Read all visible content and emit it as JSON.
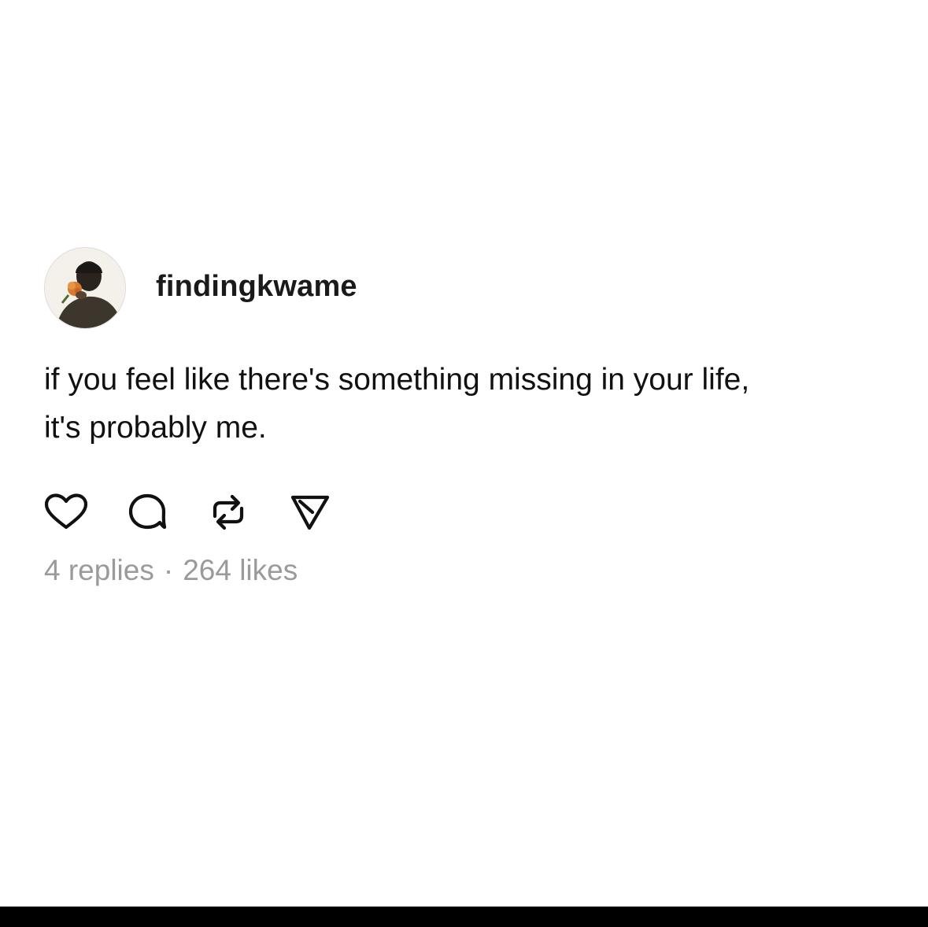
{
  "post": {
    "username": "findingkwame",
    "text_lines": [
      "if you feel like there's something missing in your life,",
      "it's probably me."
    ],
    "actions": [
      {
        "icon": "heart-icon"
      },
      {
        "icon": "comment-icon"
      },
      {
        "icon": "repost-icon"
      },
      {
        "icon": "send-icon"
      }
    ],
    "stats": {
      "replies": "4 replies",
      "separator": "·",
      "likes": "264 likes"
    }
  },
  "colors": {
    "text": "#111111",
    "username": "#1a1a1a",
    "muted": "#9a9a9a",
    "background": "#ffffff",
    "bottom_bar": "#000000"
  }
}
